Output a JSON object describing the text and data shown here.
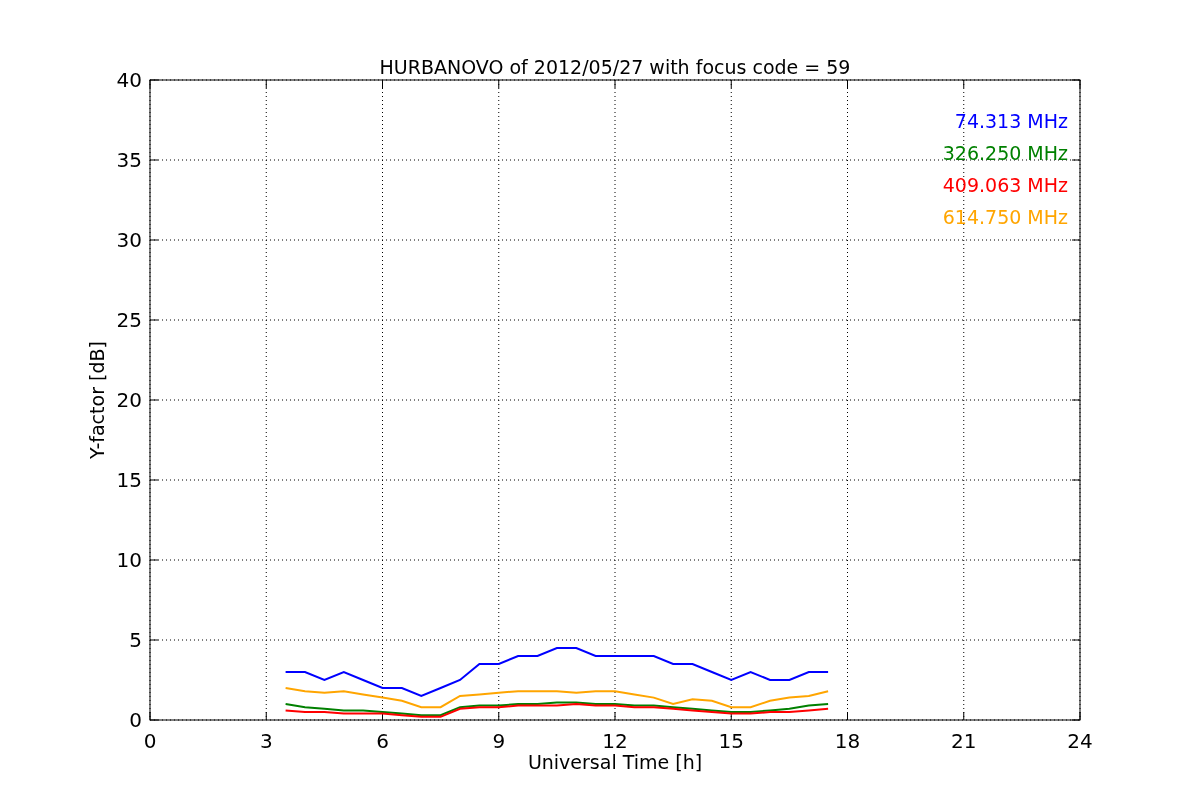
{
  "chart_data": {
    "type": "line",
    "title": "HURBANOVO of 2012/05/27 with focus code = 59",
    "xlabel": "Universal Time [h]",
    "ylabel": "Y-factor [dB]",
    "x": [
      3.5,
      4,
      4.5,
      5,
      5.5,
      6,
      6.5,
      7,
      7.5,
      8,
      8.5,
      9,
      9.5,
      10,
      10.5,
      11,
      11.5,
      12,
      12.5,
      13,
      13.5,
      14,
      14.5,
      15,
      15.5,
      16,
      16.5,
      17,
      17.5
    ],
    "series": [
      {
        "name": "74.313 MHz",
        "color": "#0000ff",
        "values": [
          3,
          3,
          2.5,
          3,
          2.5,
          2,
          2,
          1.5,
          2,
          2.5,
          3.5,
          3.5,
          4,
          4,
          4.5,
          4.5,
          4,
          4,
          4,
          4,
          3.5,
          3.5,
          3,
          2.5,
          3,
          2.5,
          2.5,
          3,
          3
        ]
      },
      {
        "name": "326.250 MHz",
        "color": "#008000",
        "values": [
          1,
          0.8,
          0.7,
          0.6,
          0.6,
          0.5,
          0.4,
          0.3,
          0.3,
          0.8,
          0.9,
          0.9,
          1,
          1,
          1.1,
          1.1,
          1,
          1,
          0.9,
          0.9,
          0.8,
          0.7,
          0.6,
          0.5,
          0.5,
          0.6,
          0.7,
          0.9,
          1
        ]
      },
      {
        "name": "409.063 MHz",
        "color": "#ff0000",
        "values": [
          0.6,
          0.5,
          0.5,
          0.4,
          0.4,
          0.4,
          0.3,
          0.2,
          0.2,
          0.7,
          0.8,
          0.8,
          0.9,
          0.9,
          0.9,
          1,
          0.9,
          0.9,
          0.8,
          0.8,
          0.7,
          0.6,
          0.5,
          0.4,
          0.4,
          0.5,
          0.5,
          0.6,
          0.7
        ]
      },
      {
        "name": "614.750 MHz",
        "color": "#ffa500",
        "values": [
          2,
          1.8,
          1.7,
          1.8,
          1.6,
          1.4,
          1.2,
          0.8,
          0.8,
          1.5,
          1.6,
          1.7,
          1.8,
          1.8,
          1.8,
          1.7,
          1.8,
          1.8,
          1.6,
          1.4,
          1,
          1.3,
          1.2,
          0.8,
          0.8,
          1.2,
          1.4,
          1.5,
          1.8
        ]
      }
    ],
    "grid": true,
    "xlim": [
      0,
      24
    ],
    "ylim": [
      0,
      40
    ],
    "xticks": [
      0,
      3,
      6,
      9,
      12,
      15,
      18,
      21,
      24
    ],
    "yticks": [
      0,
      5,
      10,
      15,
      20,
      25,
      30,
      35,
      40
    ]
  }
}
